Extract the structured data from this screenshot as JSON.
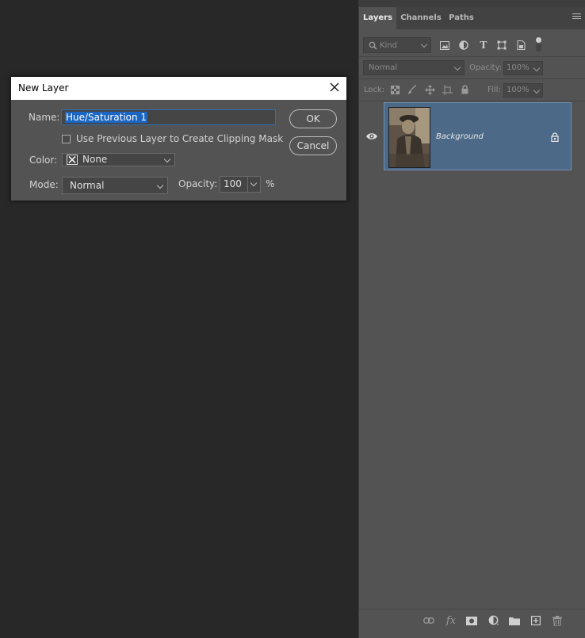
{
  "panel": {
    "tabs": [
      {
        "label": "Layers",
        "active": true
      },
      {
        "label": "Channels",
        "active": false
      },
      {
        "label": "Paths",
        "active": false
      }
    ],
    "filter": {
      "kind_label": "Kind"
    },
    "blend_mode": "Normal",
    "opacity_label": "Opacity:",
    "opacity_value": "100%",
    "lock_label": "Lock:",
    "fill_label": "Fill:",
    "fill_value": "100%",
    "layers": [
      {
        "name": "Background",
        "visible": true,
        "locked": true,
        "selected": true
      }
    ],
    "icons": {
      "filter": [
        "image-filter-icon",
        "adjustment-filter-icon",
        "type-filter-icon",
        "shape-filter-icon",
        "smart-object-filter-icon",
        "filter-toggle-icon"
      ],
      "lock": [
        "lock-transparent-pixels-icon",
        "lock-image-pixels-icon",
        "lock-position-icon",
        "lock-artboard-icon",
        "lock-all-icon"
      ],
      "bottom": [
        "link-layers-icon",
        "fx-icon",
        "add-mask-icon",
        "new-adjustment-layer-icon",
        "new-group-icon",
        "new-layer-icon",
        "delete-layer-icon"
      ]
    }
  },
  "dialog": {
    "title": "New Layer",
    "name_label": "Name:",
    "name_value": "Hue/Saturation 1",
    "clipping_label": "Use Previous Layer to Create Clipping Mask",
    "clipping_checked": false,
    "color_label": "Color:",
    "color_value": "None",
    "mode_label": "Mode:",
    "mode_value": "Normal",
    "opacity_label": "Opacity:",
    "opacity_value": "100",
    "opacity_unit": "%",
    "ok_label": "OK",
    "cancel_label": "Cancel"
  },
  "colors": {
    "canvas_bg": "#282828",
    "panel_bg": "#535353",
    "selection_blue": "#4c6a88",
    "highlight": "#1b66c2"
  }
}
